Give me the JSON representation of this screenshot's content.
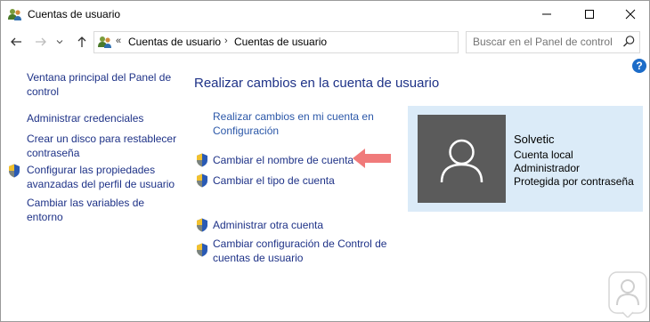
{
  "window": {
    "title": "Cuentas de usuario"
  },
  "nav": {
    "breadcrumb": [
      "Cuentas de usuario",
      "Cuentas de usuario"
    ],
    "search_placeholder": "Buscar en el Panel de control"
  },
  "left_pane": {
    "items": [
      {
        "label": "Ventana principal del Panel de control",
        "lines": [
          "Ventana principal del Panel de",
          "control"
        ],
        "shield": false
      },
      {
        "label": "Administrar credenciales",
        "lines": [
          "Administrar credenciales"
        ],
        "shield": false
      },
      {
        "label": "Crear un disco para restablecer contraseña",
        "lines": [
          "Crear un disco para restablecer",
          "contraseña"
        ],
        "shield": false
      },
      {
        "label": "Configurar las propiedades avanzadas del perfil de usuario",
        "lines": [
          "Configurar las propiedades",
          "avanzadas del perfil de usuario"
        ],
        "shield": true
      },
      {
        "label": "Cambiar las variables de entorno",
        "lines": [
          "Cambiar las variables de",
          "entorno"
        ],
        "shield": false
      }
    ]
  },
  "main": {
    "heading": "Realizar cambios en la cuenta de usuario",
    "links": [
      {
        "lines": [
          "Realizar cambios en mi cuenta en",
          "Configuración"
        ],
        "shield": false
      },
      {
        "lines": [
          "Cambiar el nombre de cuenta"
        ],
        "shield": true
      },
      {
        "lines": [
          "Cambiar el tipo de cuenta"
        ],
        "shield": true
      },
      {
        "lines": [
          "Administrar otra cuenta"
        ],
        "shield": true
      },
      {
        "lines": [
          "Cambiar configuración de Control de",
          "cuentas de usuario"
        ],
        "shield": true
      }
    ]
  },
  "account": {
    "name": "Solvetic",
    "details": [
      "Cuenta local",
      "Administrador",
      "Protegida por contraseña"
    ]
  },
  "help_glyph": "?",
  "colors": {
    "link": "#1e3287",
    "card_bg": "#dbebf8",
    "avatar_bg": "#5b5b5b",
    "arrow": "#f07a7a",
    "help": "#1c6cc8"
  },
  "icons": [
    "users-icon",
    "minimize-icon",
    "maximize-icon",
    "close-icon",
    "back-arrow-icon",
    "forward-arrow-icon",
    "recent-dropdown-icon",
    "up-arrow-icon",
    "refresh-icon",
    "search-icon",
    "help-icon",
    "shield-icon",
    "user-avatar-icon",
    "pointer-arrow-icon",
    "watermark-logo-icon"
  ]
}
